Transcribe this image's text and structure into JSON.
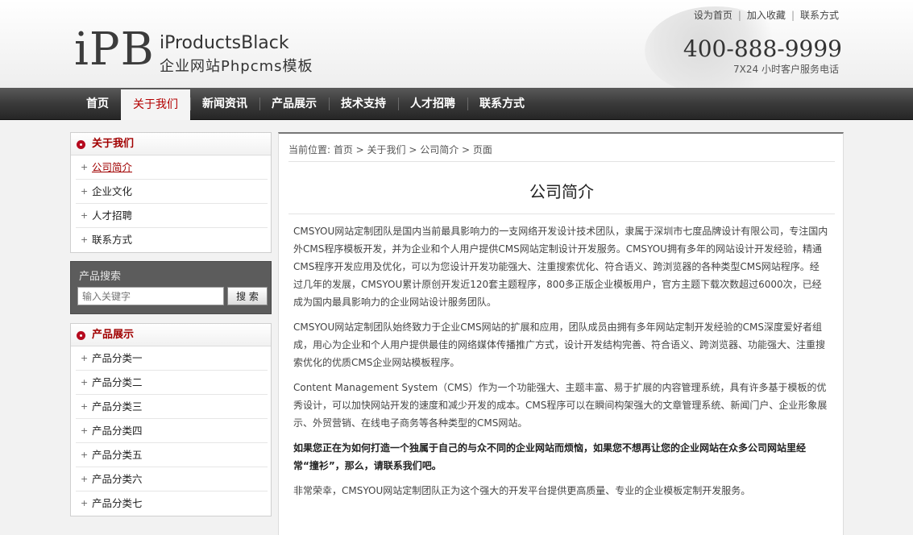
{
  "header": {
    "logo_mark": "iPB",
    "logo_title": "iProductsBlack",
    "logo_subtitle": "企业网站Phpcms模板",
    "top_links": [
      "设为首页",
      "加入收藏",
      "联系方式"
    ],
    "top_links_sep": "|",
    "phone": "400-888-9999",
    "phone_note": "7X24 小时客户服务电话"
  },
  "nav": {
    "items": [
      "首页",
      "关于我们",
      "新闻资讯",
      "产品展示",
      "技术支持",
      "人才招聘",
      "联系方式"
    ],
    "active_index": 1
  },
  "sidebar": {
    "about": {
      "title": "关于我们",
      "items": [
        "公司简介",
        "企业文化",
        "人才招聘",
        "联系方式"
      ],
      "current_index": 0
    },
    "search": {
      "title": "产品搜索",
      "placeholder": "输入关键字",
      "button": "搜 索"
    },
    "products": {
      "title": "产品展示",
      "items": [
        "产品分类一",
        "产品分类二",
        "产品分类三",
        "产品分类四",
        "产品分类五",
        "产品分类六",
        "产品分类七"
      ]
    }
  },
  "main": {
    "breadcrumb": "当前位置: 首页 > 关于我们 > 公司简介 > 页面",
    "title": "公司简介",
    "paragraphs": [
      "CMSYOU网站定制团队是国内当前最具影响力的一支网络开发设计技术团队，隶属于深圳市七度品牌设计有限公司，专注国内外CMS程序模板开发，并为企业和个人用户提供CMS网站定制设计开发服务。CMSYOU拥有多年的网站设计开发经验，精通CMS程序开发应用及优化，可以为您设计开发功能强大、注重搜索优化、符合语义、跨浏览器的各种类型CMS网站程序。经过几年的发展，CMSYOU累计原创开发近120套主题程序，800多正版企业模板用户，官方主题下载次数超过6000次，已经成为国内最具影响力的企业网站设计服务团队。",
      "CMSYOU网站定制团队始终致力于企业CMS网站的扩展和应用，团队成员由拥有多年网站定制开发经验的CMS深度爱好者组成，用心为企业和个人用户提供最佳的网络媒体传播推广方式，设计开发结构完善、符合语义、跨浏览器、功能强大、注重搜索优化的优质CMS企业网站模板程序。",
      "Content Management System（CMS）作为一个功能强大、主题丰富、易于扩展的内容管理系统，具有许多基于模板的优秀设计，可以加快网站开发的速度和减少开发的成本。CMS程序可以在瞬间构架强大的文章管理系统、新闻门户、企业形象展示、外贸营销、在线电子商务等各种类型的CMS网站。",
      "如果您正在为如何打造一个独属于自己的与众不同的企业网站而烦恼，如果您不想再让您的企业网站在众多公司网站里经常“撞衫”，那么，请联系我们吧。",
      "非常荣幸，CMSYOU网站定制团队正为这个强大的开发平台提供更高质量、专业的企业模板定制开发服务。"
    ],
    "bold_paragraph_index": 3
  },
  "colors": {
    "accent_red": "#a10000",
    "nav_bg": "#3a3a3a",
    "bullet": "#b50a1e"
  }
}
